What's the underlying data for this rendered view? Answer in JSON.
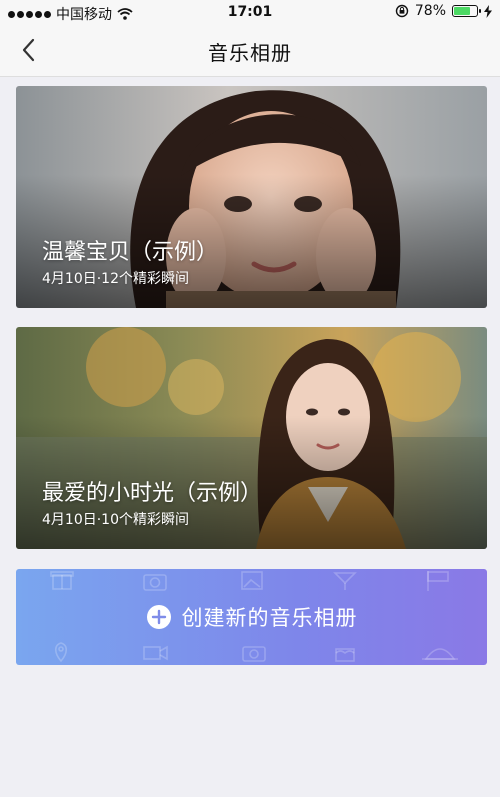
{
  "status_bar": {
    "carrier": "中国移动",
    "time": "17:01",
    "battery_pct": "78%",
    "battery_level": 0.78,
    "icons": [
      "signal-dots-icon",
      "wifi-icon",
      "rotation-lock-icon",
      "battery-icon",
      "charging-icon"
    ]
  },
  "nav": {
    "title": "音乐相册",
    "back_icon": "chevron-left-icon"
  },
  "albums": [
    {
      "title": "温馨宝贝（示例）",
      "subtitle": "4月10日·12个精彩瞬间"
    },
    {
      "title": "最爱的小时光（示例）",
      "subtitle": "4月10日·10个精彩瞬间"
    }
  ],
  "create": {
    "label": "创建新的音乐相册",
    "icon": "plus-circle-icon",
    "decor_icons": [
      "gift-icon",
      "camera-icon",
      "picture-icon",
      "cocktail-icon",
      "flag-icon",
      "pin-icon",
      "video-camera-icon",
      "radio-icon",
      "cake-icon",
      "food-cover-icon"
    ]
  },
  "colors": {
    "background": "#efeff4",
    "bar": "#f7f7f7",
    "gradient_start": "#7aa6ef",
    "gradient_end": "#8a79e6",
    "battery": "#4cd964"
  }
}
